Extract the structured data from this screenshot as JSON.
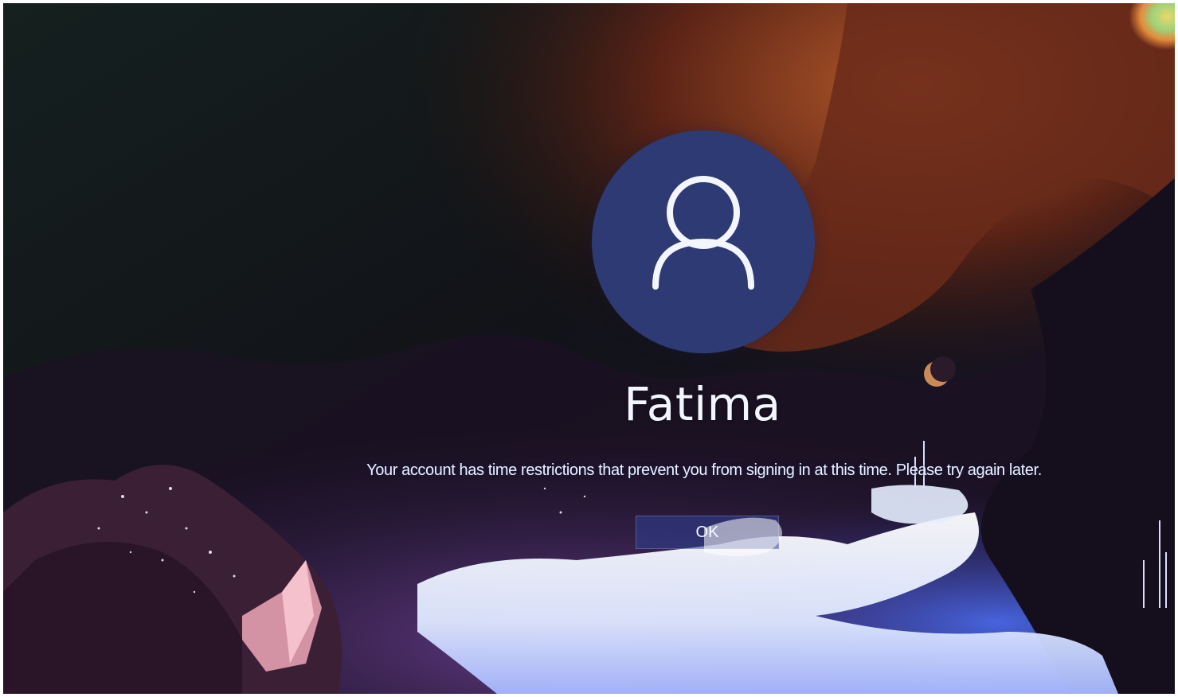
{
  "user": {
    "name": "Fatima",
    "avatar_icon": "person-outline-icon"
  },
  "message": {
    "text": "Your account has time restrictions that prevent you from signing in at this time. Please try again later."
  },
  "actions": {
    "ok_label": "OK"
  },
  "colors": {
    "avatar_background": "#2d3a74",
    "button_background": "#304296",
    "text": "#f4f6ff"
  }
}
